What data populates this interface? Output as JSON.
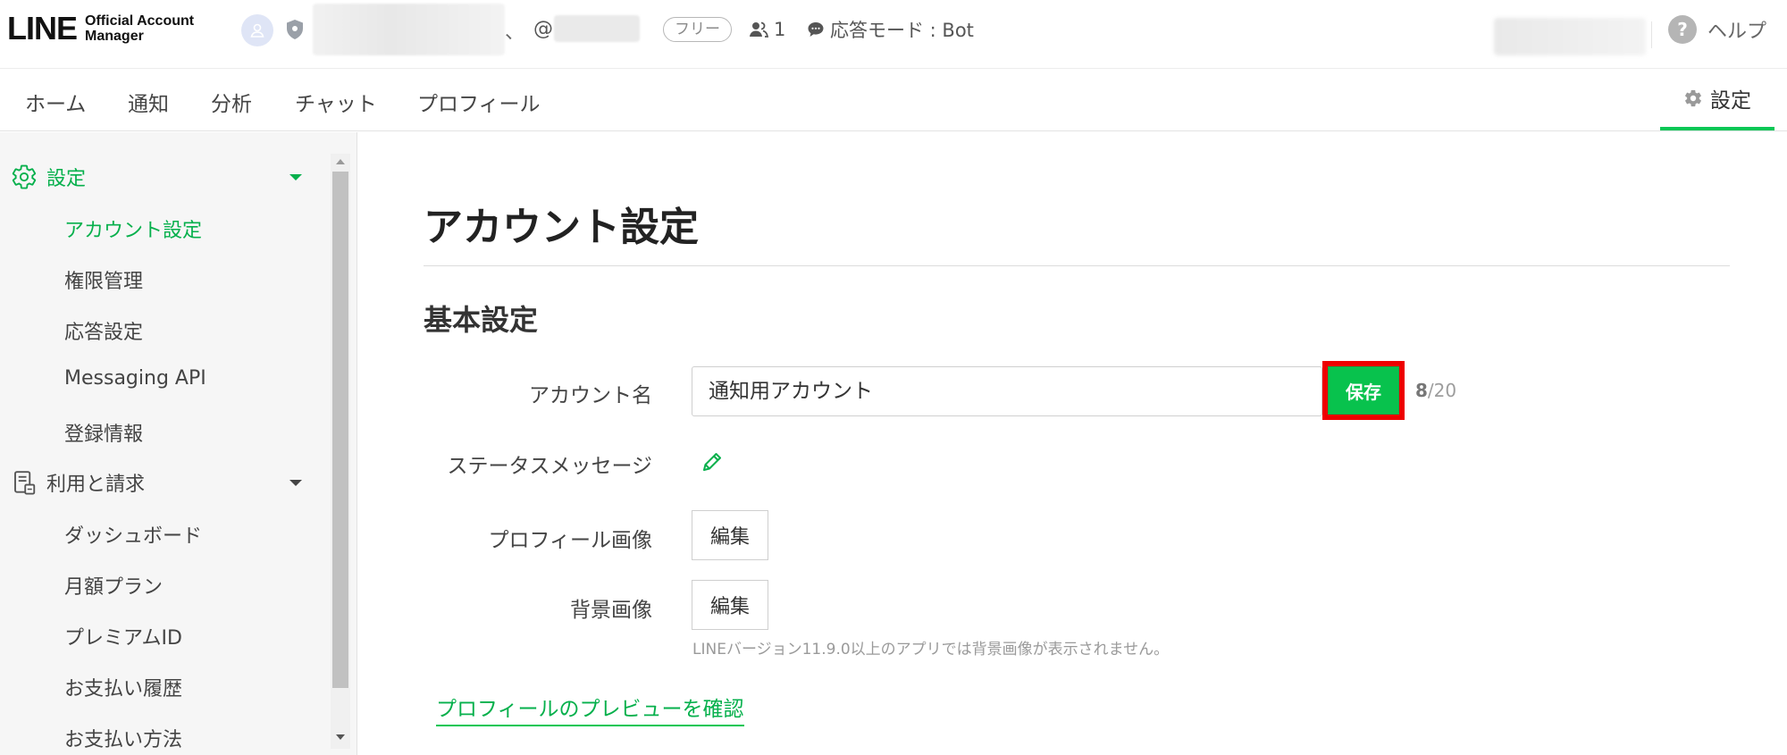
{
  "brand": {
    "logo_main": "LINE",
    "logo_sub_line1": "Official Account",
    "logo_sub_line2": "Manager"
  },
  "header": {
    "account_name_suffix": "、",
    "account_id_prefix": "@",
    "plan": "フリー",
    "friend_count": "1",
    "response_mode": "応答モード : Bot",
    "help": "ヘルプ"
  },
  "nav": {
    "tabs": [
      {
        "label": "ホーム"
      },
      {
        "label": "通知"
      },
      {
        "label": "分析"
      },
      {
        "label": "チャット"
      },
      {
        "label": "プロフィール"
      }
    ],
    "settings": "設定"
  },
  "sidebar": {
    "groups": [
      {
        "label": "設定",
        "icon": "gear-icon",
        "items": [
          "アカウント設定",
          "権限管理",
          "応答設定",
          "Messaging API",
          "登録情報"
        ]
      },
      {
        "label": "利用と請求",
        "icon": "invoice-icon",
        "items": [
          "ダッシュボード",
          "月額プラン",
          "プレミアムID",
          "お支払い履歴",
          "お支払い方法"
        ]
      }
    ]
  },
  "main": {
    "page_title": "アカウント設定",
    "section_title": "基本設定",
    "account_name_label": "アカウント名",
    "account_name_value": "通知用アカウント",
    "save_label": "保存",
    "char_count": "8",
    "char_max": "/20",
    "status_message_label": "ステータスメッセージ",
    "profile_image_label": "プロフィール画像",
    "profile_image_edit": "編集",
    "background_image_label": "背景画像",
    "background_image_edit": "編集",
    "background_hint": "LINEバージョン11.9.0以上のアプリでは背景画像が表示されません。",
    "preview_link": "プロフィールのプレビューを確認"
  },
  "colors": {
    "accent_green": "#06c755",
    "highlight_red": "#ee0000"
  }
}
